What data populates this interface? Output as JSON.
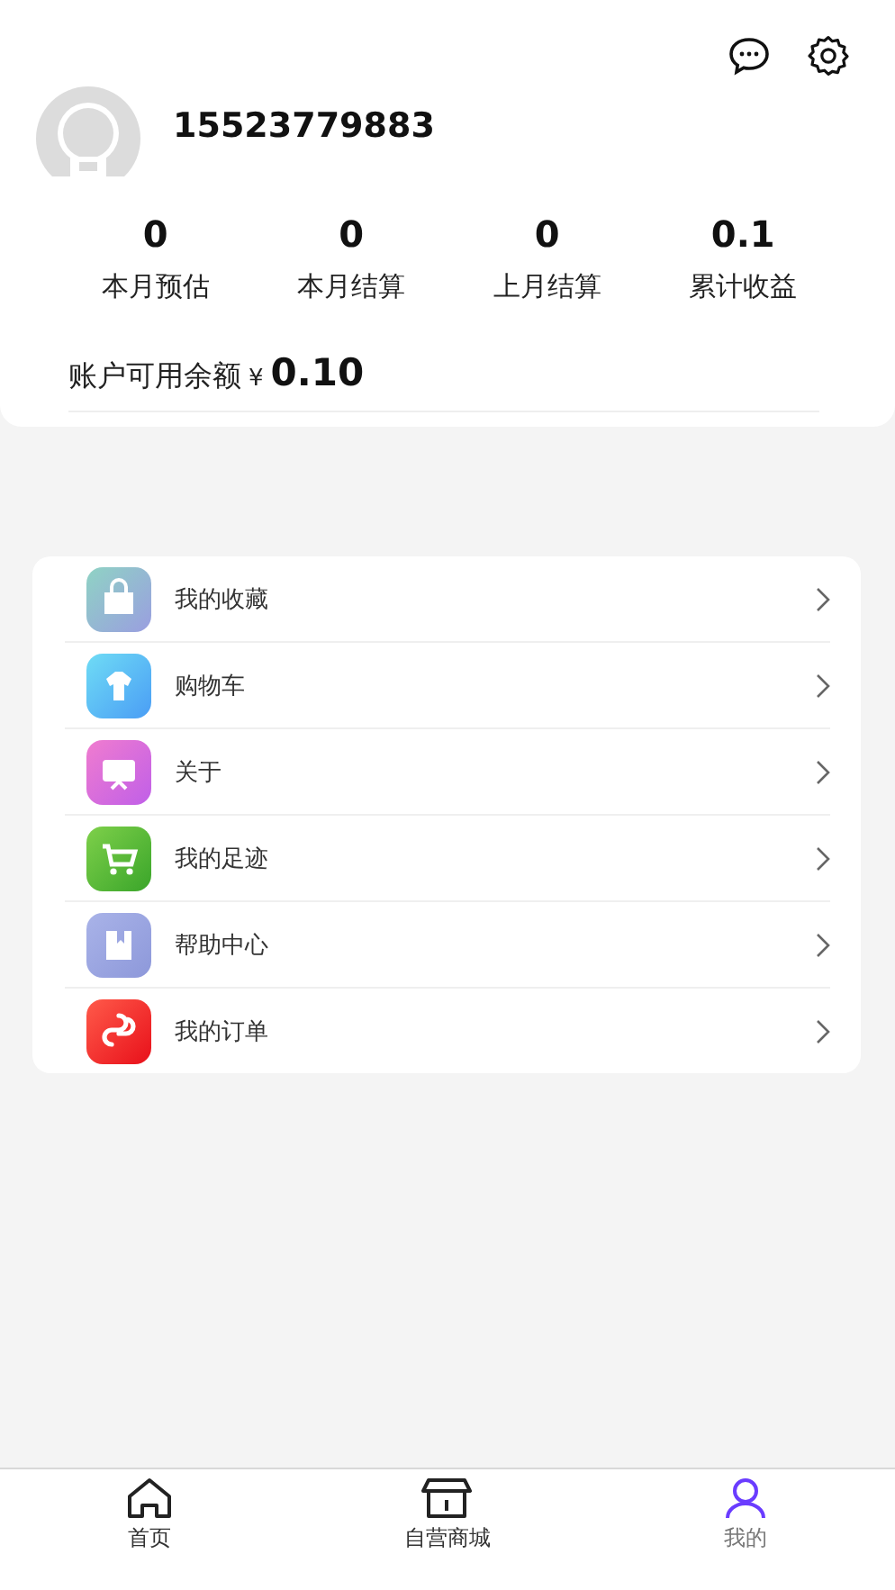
{
  "profile": {
    "phone": "15523779883"
  },
  "stats": [
    {
      "value": "0",
      "label": "本月预估"
    },
    {
      "value": "0",
      "label": "本月结算"
    },
    {
      "value": "0",
      "label": "上月结算"
    },
    {
      "value": "0.1",
      "label": "累计收益"
    }
  ],
  "balance": {
    "label": "账户可用余额",
    "currency": "¥",
    "amount": "0.10"
  },
  "menu": [
    {
      "kind": "bag",
      "label": "我的收藏"
    },
    {
      "kind": "shirt",
      "label": "购物车"
    },
    {
      "kind": "screen",
      "label": "关于"
    },
    {
      "kind": "cart",
      "label": "我的足迹"
    },
    {
      "kind": "book",
      "label": "帮助中心"
    },
    {
      "kind": "link",
      "label": "我的订单"
    }
  ],
  "tab_bar": [
    {
      "kind": "home",
      "label": "首页",
      "selected": false
    },
    {
      "kind": "shop",
      "label": "自营商城",
      "selected": false
    },
    {
      "kind": "user",
      "label": "我的",
      "selected": true
    }
  ]
}
